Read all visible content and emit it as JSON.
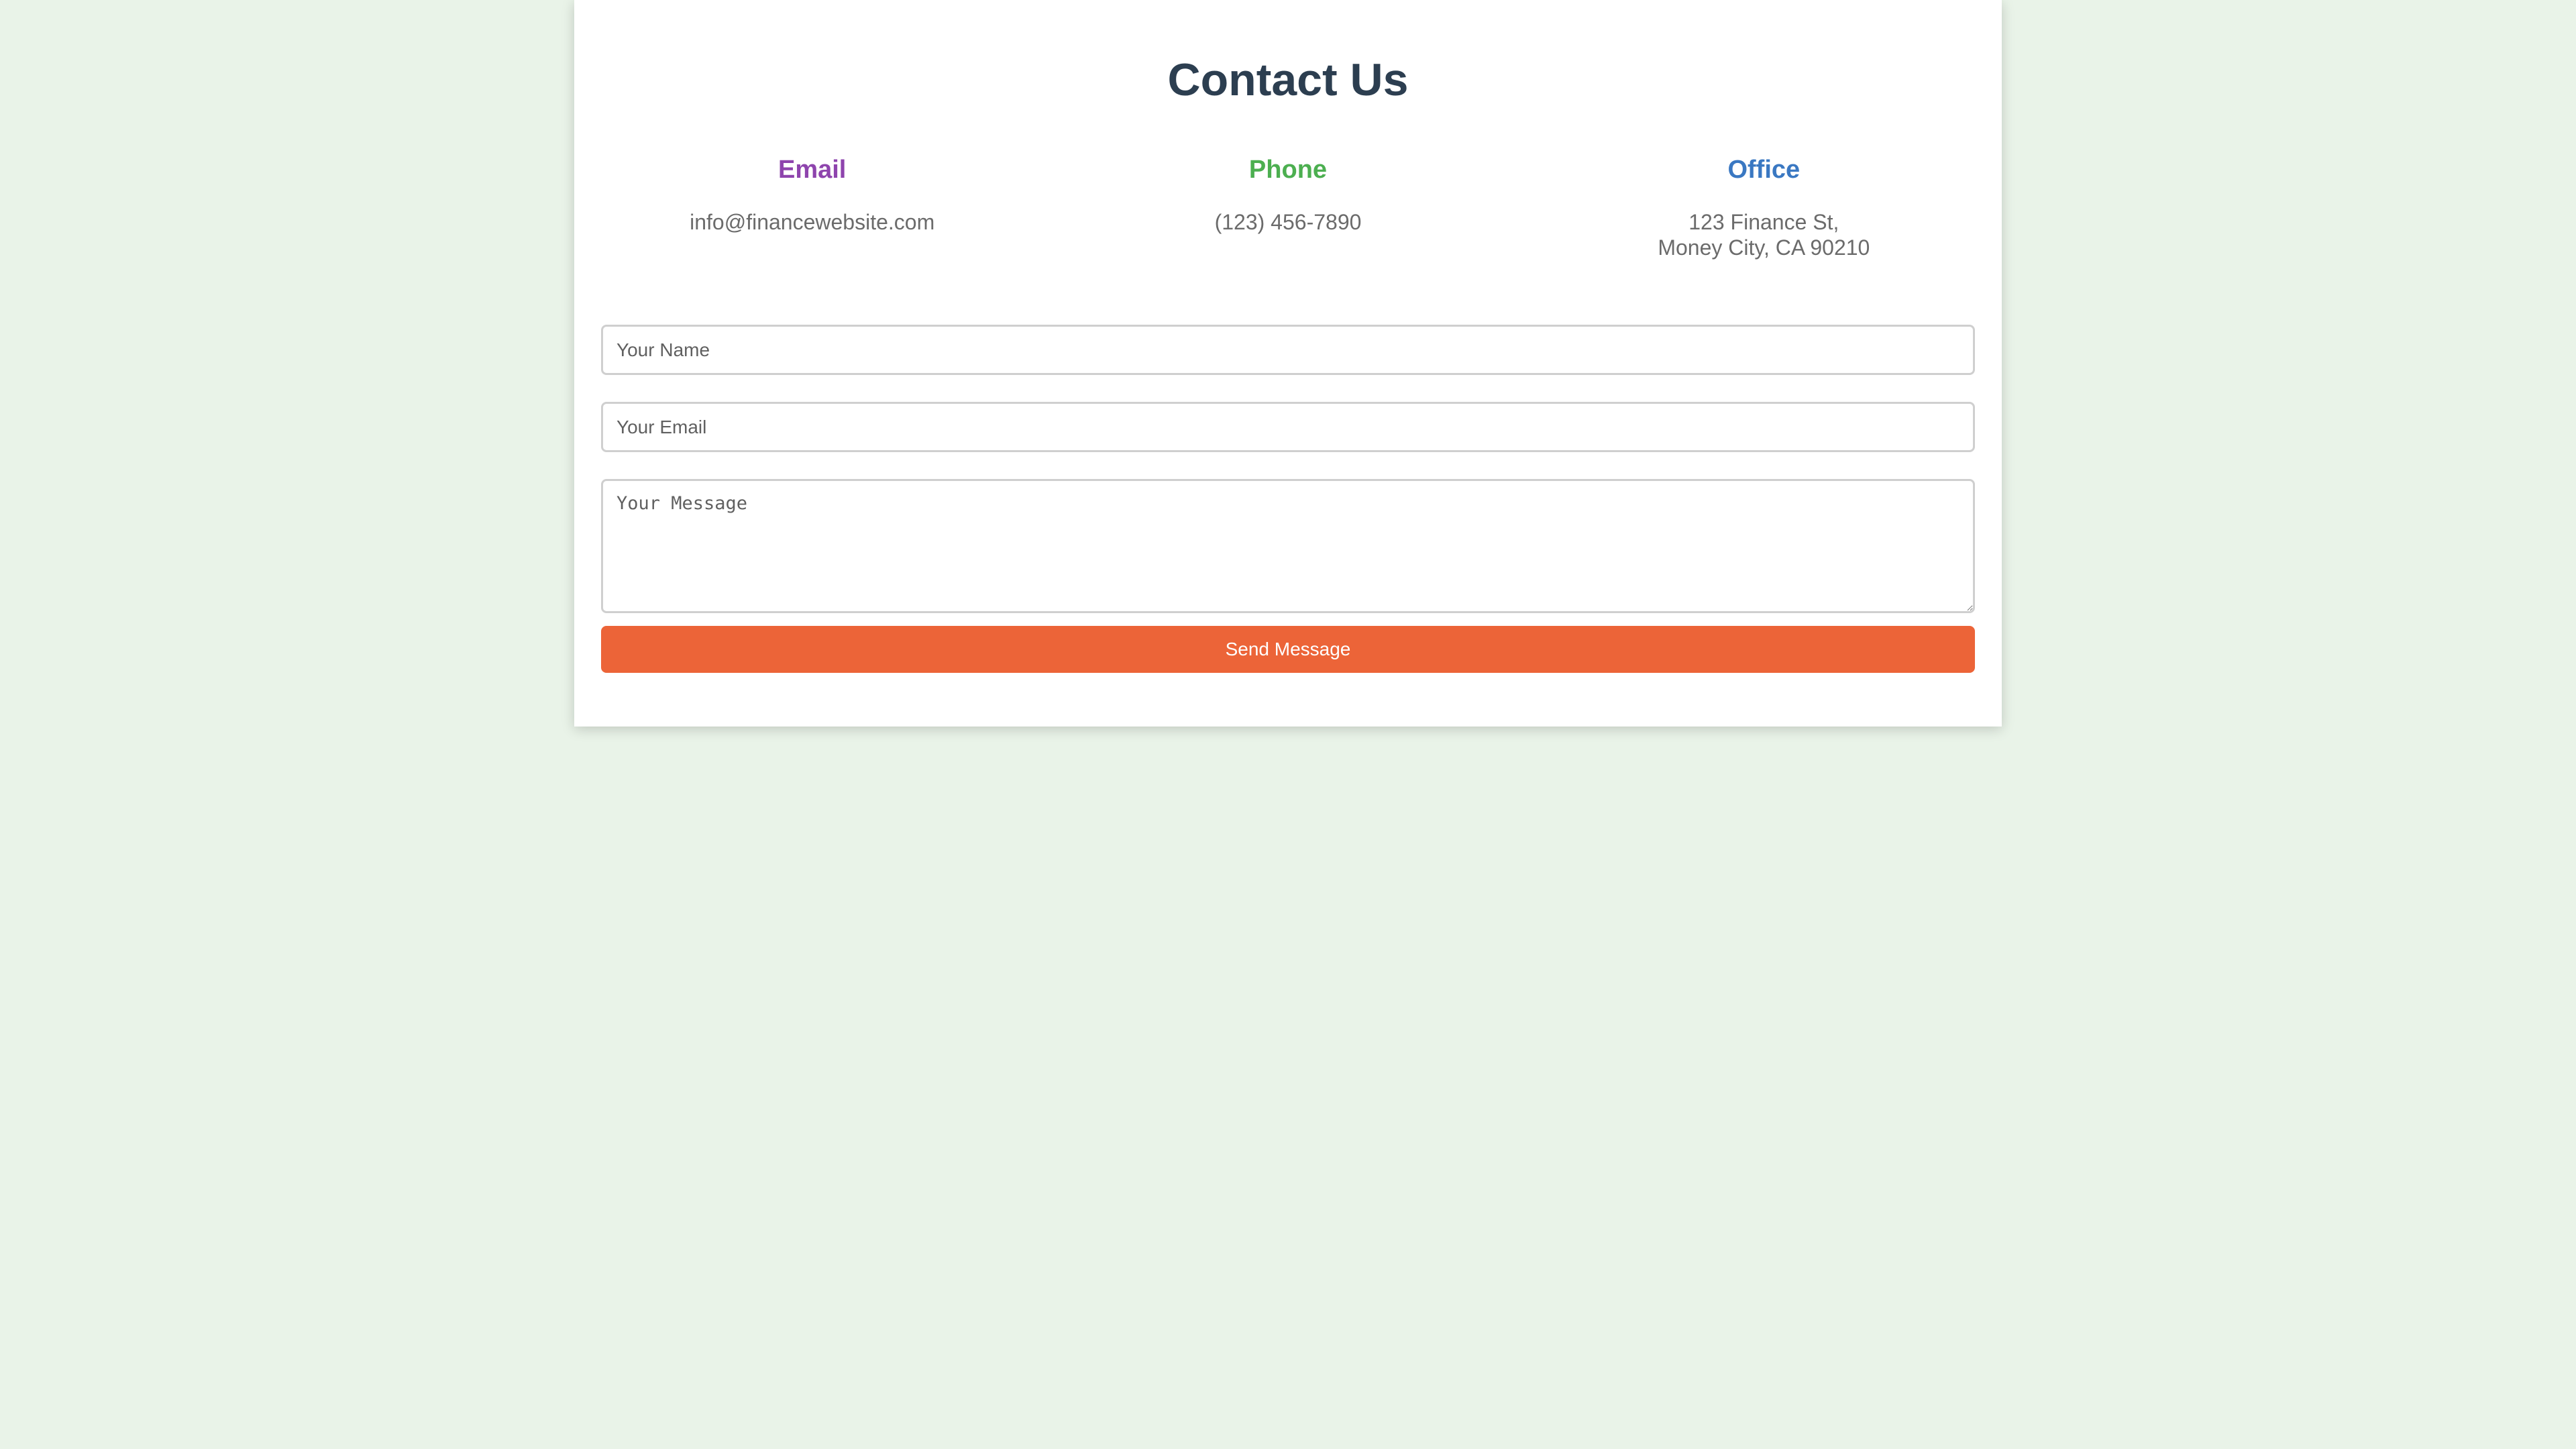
{
  "page": {
    "title": "Contact Us"
  },
  "contact_info": [
    {
      "heading": "Email",
      "lines": [
        "info@financewebsite.com"
      ],
      "color": "#8e44ad"
    },
    {
      "heading": "Phone",
      "lines": [
        "(123) 456-7890"
      ],
      "color": "#4caf50"
    },
    {
      "heading": "Office",
      "lines": [
        "123 Finance St,",
        "Money City, CA 90210"
      ],
      "color": "#3a78c2"
    }
  ],
  "form": {
    "name_placeholder": "Your Name",
    "email_placeholder": "Your Email",
    "message_placeholder": "Your Message",
    "submit_label": "Send Message"
  },
  "colors": {
    "background": "#e9f3e8",
    "title": "#2c3e50",
    "button": "#ec6438"
  }
}
